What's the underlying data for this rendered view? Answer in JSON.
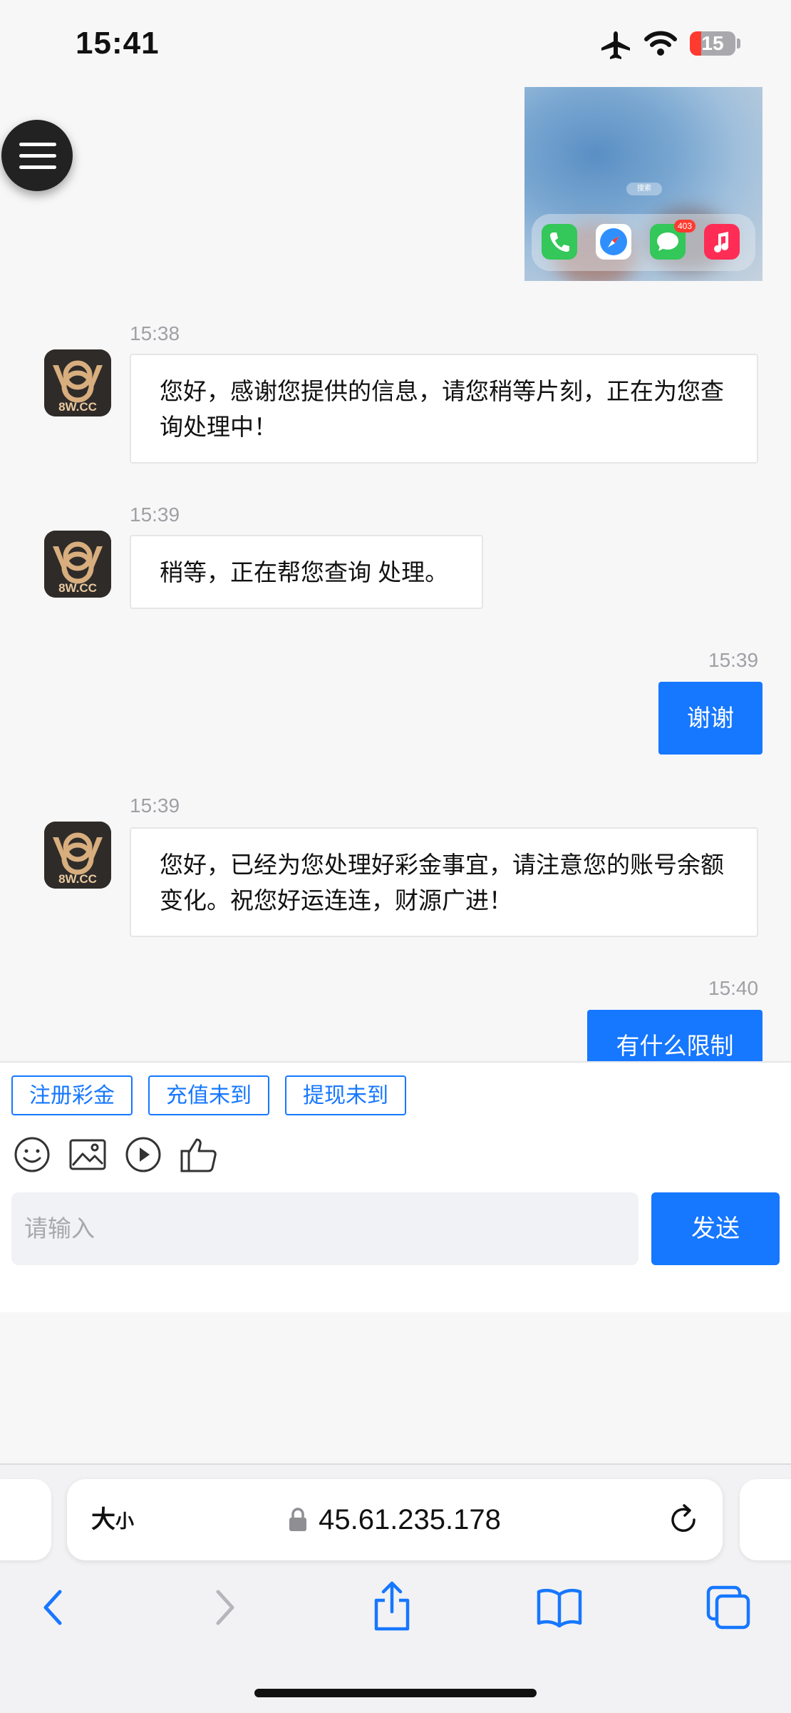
{
  "status_bar": {
    "time": "15:41",
    "battery": "15"
  },
  "chat": {
    "messages": [
      {
        "sender": "agent",
        "time": "15:38",
        "text": "您好，感谢您提供的信息，请您稍等片刻，正在为您查询处理中！"
      },
      {
        "sender": "agent",
        "time": "15:39",
        "text": "稍等，正在帮您查询 处理。"
      },
      {
        "sender": "user",
        "time": "15:39",
        "text": "谢谢"
      },
      {
        "sender": "agent",
        "time": "15:39",
        "text": "您好，已经为您处理好彩金事宜，请注意您的账号余额变化。祝您好运连连，财源广进！"
      },
      {
        "sender": "user",
        "time": "15:40",
        "text": "有什么限制"
      }
    ],
    "avatar_text": "8W.CC",
    "image_message": {
      "search_label": "搜索",
      "dock_badge": "403"
    }
  },
  "quick_replies": [
    "注册彩金",
    "充值未到",
    "提现未到"
  ],
  "composer": {
    "placeholder": "请输入",
    "send_label": "发送"
  },
  "browser": {
    "text_size_big": "大",
    "text_size_small": "小",
    "url": "45.61.235.178"
  },
  "colors": {
    "accent": "#1677ff",
    "bubble_border": "#e6e6e9"
  }
}
